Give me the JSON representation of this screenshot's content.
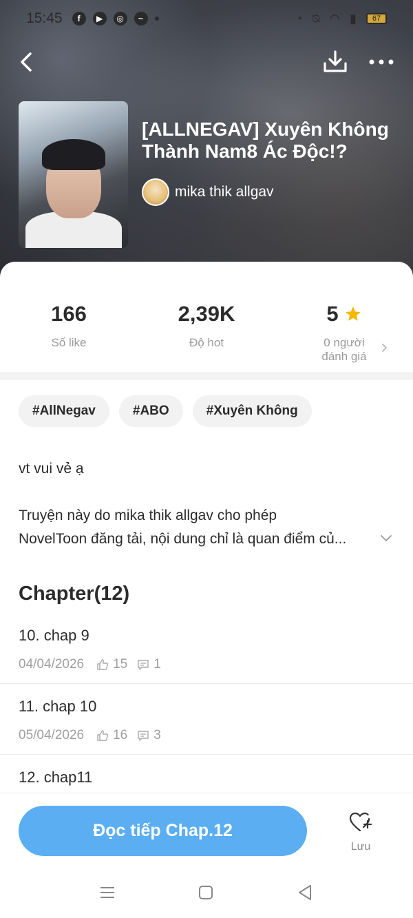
{
  "status_bar": {
    "time": "15:45",
    "battery": "67"
  },
  "book": {
    "title": "[ALLNEGAV] Xuyên Không Thành Nam8 Ác Độc!?",
    "author": "mika thik allgav"
  },
  "stats": [
    {
      "value": "166",
      "label": "Số like"
    },
    {
      "value": "2,39K",
      "label": "Độ hot"
    },
    {
      "value": "5",
      "label": "0 người đánh giá"
    }
  ],
  "tags": [
    "#AllNegav",
    "#ABO",
    "#Xuyên Không"
  ],
  "description": {
    "line1": "vt vui vẻ ạ",
    "line2": "Truyện này do mika thik allgav cho phép",
    "line3": "NovelToon đăng tải, nội dung chỉ là quan điểm củ..."
  },
  "chapters": {
    "header": "Chapter(12)",
    "items": [
      {
        "title": "10. chap 9",
        "date": "04/04/2026",
        "likes": "15",
        "comments": "1"
      },
      {
        "title": "11. chap 10",
        "date": "05/04/2026",
        "likes": "16",
        "comments": "3"
      },
      {
        "title": "12. chap11",
        "date": "",
        "likes": "",
        "comments": ""
      }
    ]
  },
  "actions": {
    "read_label": "Đọc tiếp Chap.12",
    "save_label": "Lưu"
  },
  "colors": {
    "accent": "#5baef2",
    "star": "#f5b800"
  },
  "icons": {
    "back": "chevron-left-icon",
    "download": "download-icon",
    "more": "more-dots-icon",
    "star": "star-icon",
    "like": "thumb-up-icon",
    "comment": "comment-icon",
    "save": "heart-plus-icon"
  }
}
